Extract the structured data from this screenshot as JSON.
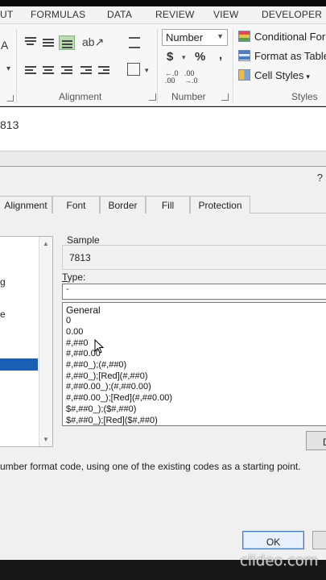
{
  "ribbon_tabs": [
    "UT",
    "FORMULAS",
    "DATA",
    "REVIEW",
    "VIEW",
    "DEVELOPER"
  ],
  "ribbon": {
    "font_partial_letter": "A",
    "alignment_label": "Alignment",
    "number_label": "Number",
    "styles_label": "Styles",
    "number_format_value": "Number",
    "currency_symbol": "$",
    "percent_symbol": "%",
    "comma_symbol": ",",
    "increase_decimal": "←.0\n.00",
    "decrease_decimal": ".00\n→.0",
    "conditional_formatting": "Conditional Forr",
    "format_as_table": "Format as Table",
    "cell_styles": "Cell Styles"
  },
  "formula_bar": {
    "value": "813"
  },
  "dialog": {
    "help_button": "?",
    "tabs": [
      "Alignment",
      "Font",
      "Border",
      "Fill",
      "Protection"
    ],
    "categories": [
      "g",
      "e"
    ],
    "sample_label": "Sample",
    "sample_value": "7813",
    "type_label_prefix": "",
    "type_label_underlined": "T",
    "type_label_rest": "ype:",
    "type_value": "-",
    "format_codes": [
      "General",
      "0",
      "0.00",
      "#,##0",
      "#,##0.00",
      "#,##0_);(#,##0)",
      "#,##0_);[Red](#,##0)",
      "#,##0.00_);(#,##0.00)",
      "#,##0.00_);[Red](#,##0.00)",
      "$#,##0_);($#,##0)",
      "$#,##0_);[Red]($#,##0)"
    ],
    "delete_button": "D",
    "help_text": "umber format code, using one of the existing codes as a starting point.",
    "ok_button": "OK"
  },
  "watermark": "clideo.com"
}
